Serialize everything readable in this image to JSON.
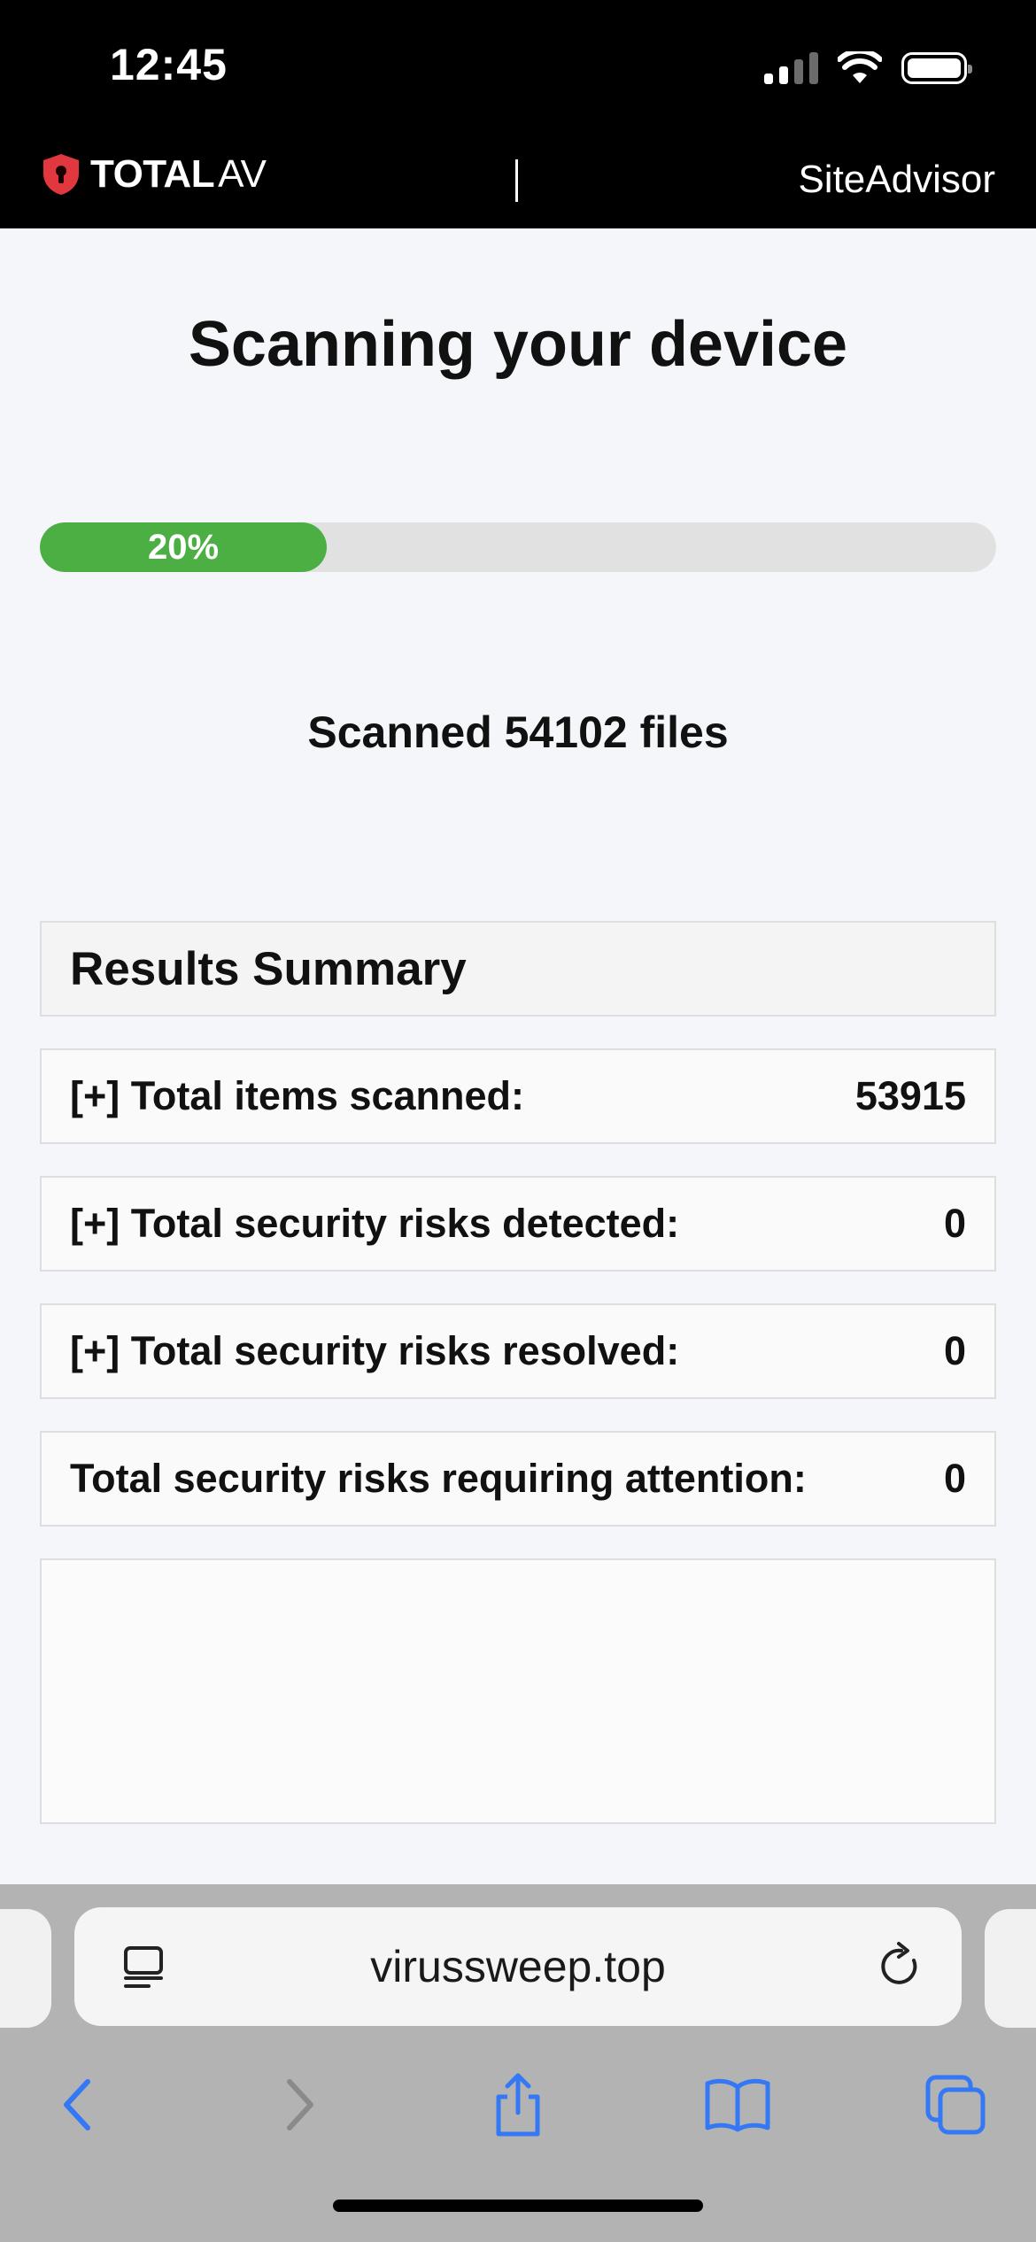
{
  "status_bar": {
    "time": "12:45"
  },
  "header": {
    "logo_bold": "TOTAL",
    "logo_light": "AV",
    "site_link": "SiteAdvisor"
  },
  "main": {
    "title": "Scanning your device",
    "progress": {
      "percent": 20,
      "label": "20%"
    },
    "scan_status": "Scanned 54102 files"
  },
  "results": {
    "header": "Results Summary",
    "rows": [
      {
        "label": "[+] Total items scanned:",
        "value": "53915"
      },
      {
        "label": "[+] Total security risks detected:",
        "value": "0"
      },
      {
        "label": "[+] Total security risks resolved:",
        "value": "0"
      },
      {
        "label": "Total security risks requiring attention:",
        "value": "0"
      }
    ]
  },
  "browser": {
    "url": "virussweep.top",
    "toolbar": [
      "back",
      "forward",
      "share",
      "bookmarks",
      "tabs"
    ]
  },
  "colors": {
    "accent_green": "#4caf44",
    "brand_red": "#e0383e",
    "safari_blue": "#3478f6"
  }
}
